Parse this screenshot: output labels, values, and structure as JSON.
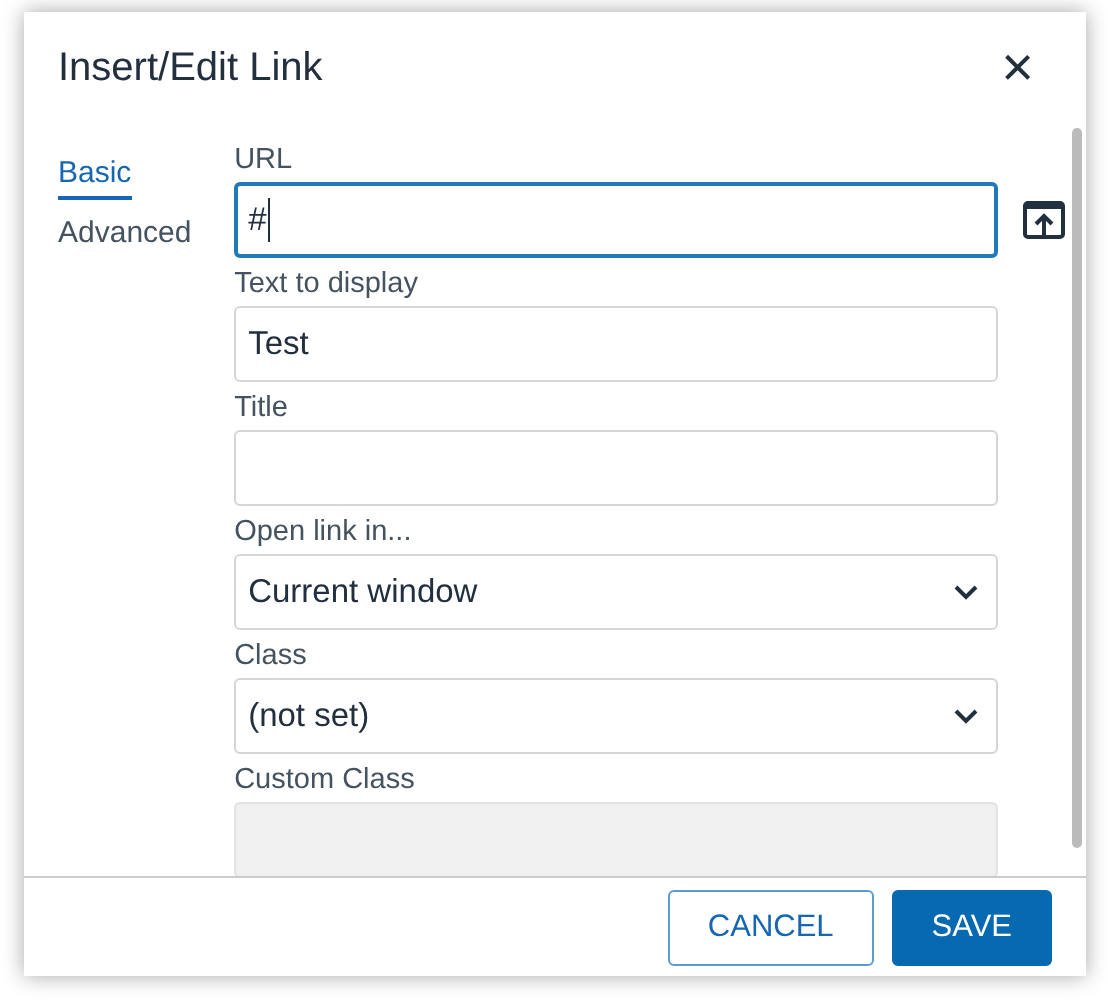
{
  "dialog": {
    "title": "Insert/Edit Link",
    "close": "×"
  },
  "tabs": [
    {
      "label": "Basic",
      "selected": true
    },
    {
      "label": "Advanced",
      "selected": false
    }
  ],
  "fields": [
    {
      "label": "URL",
      "kind": "text",
      "value": "#",
      "focused": true,
      "disabled": false,
      "browse_button": true
    },
    {
      "label": "Text to display",
      "kind": "text",
      "value": "Test",
      "focused": false,
      "disabled": false,
      "browse_button": false
    },
    {
      "label": "Title",
      "kind": "text",
      "focused": false,
      "disabled": false,
      "browse_button": false
    },
    {
      "label": "Open link in...",
      "kind": "select",
      "value": "Current window",
      "focused": false,
      "disabled": false,
      "browse_button": false
    },
    {
      "label": "Class",
      "kind": "select",
      "value": "(not set)",
      "focused": false,
      "disabled": false,
      "browse_button": false
    },
    {
      "label": "Custom Class",
      "kind": "text",
      "focused": false,
      "disabled": true,
      "browse_button": false
    }
  ],
  "buttons": [
    {
      "label": "CANCEL",
      "kind": "secondary"
    },
    {
      "label": "SAVE",
      "kind": "primary"
    }
  ]
}
